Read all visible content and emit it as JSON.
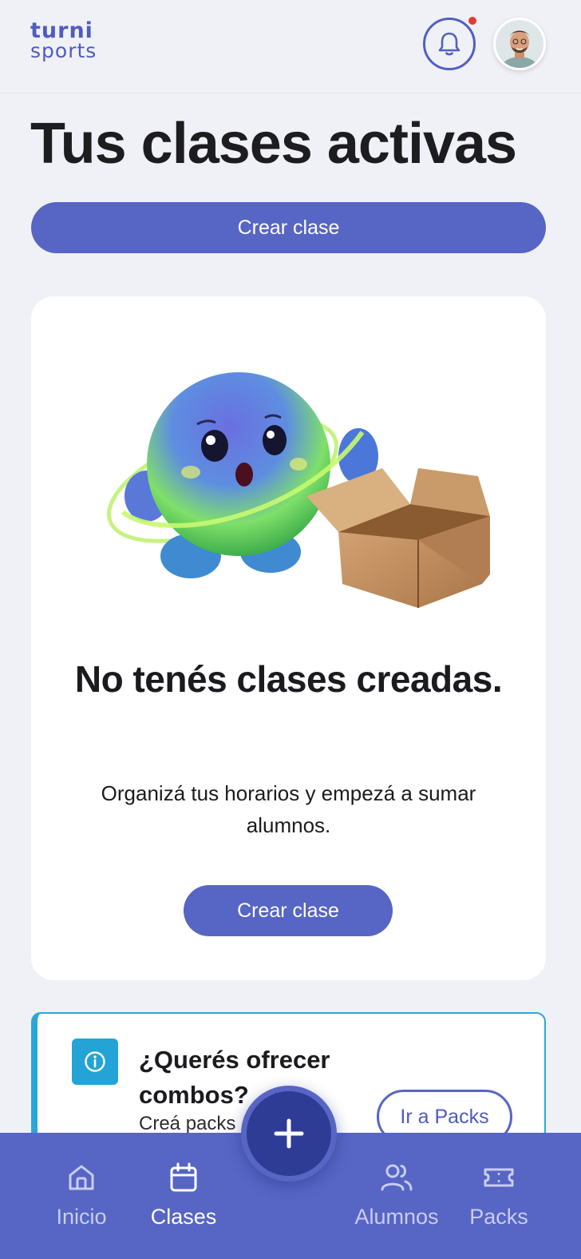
{
  "header": {
    "logo_line1": "turni",
    "logo_line2": "sports",
    "notification_icon": "bell-icon",
    "has_notification": true,
    "avatar_icon": "user-avatar"
  },
  "page": {
    "title": "Tus clases activas",
    "create_button": "Crear clase"
  },
  "empty_state": {
    "illustration": "blob-mascot-with-empty-box",
    "title": "No tenés clases creadas.",
    "subtitle": "Organizá tus horarios y empezá a sumar alumnos.",
    "button": "Crear clase"
  },
  "info_card": {
    "icon": "info-icon",
    "title": "¿Querés ofrecer combos?",
    "text": "Creá packs",
    "button": "Ir a Packs"
  },
  "bottom_nav": {
    "items": [
      {
        "label": "Inicio",
        "icon": "home-icon",
        "active": false
      },
      {
        "label": "Clases",
        "icon": "calendar-icon",
        "active": true
      },
      {
        "label": "Alumnos",
        "icon": "users-icon",
        "active": false
      },
      {
        "label": "Packs",
        "icon": "ticket-icon",
        "active": false
      }
    ],
    "fab_icon": "plus-icon"
  },
  "colors": {
    "primary": "#5765c4",
    "background": "#f0f1f7",
    "info_accent": "#2aa7d8",
    "notification": "#e53b2f"
  }
}
